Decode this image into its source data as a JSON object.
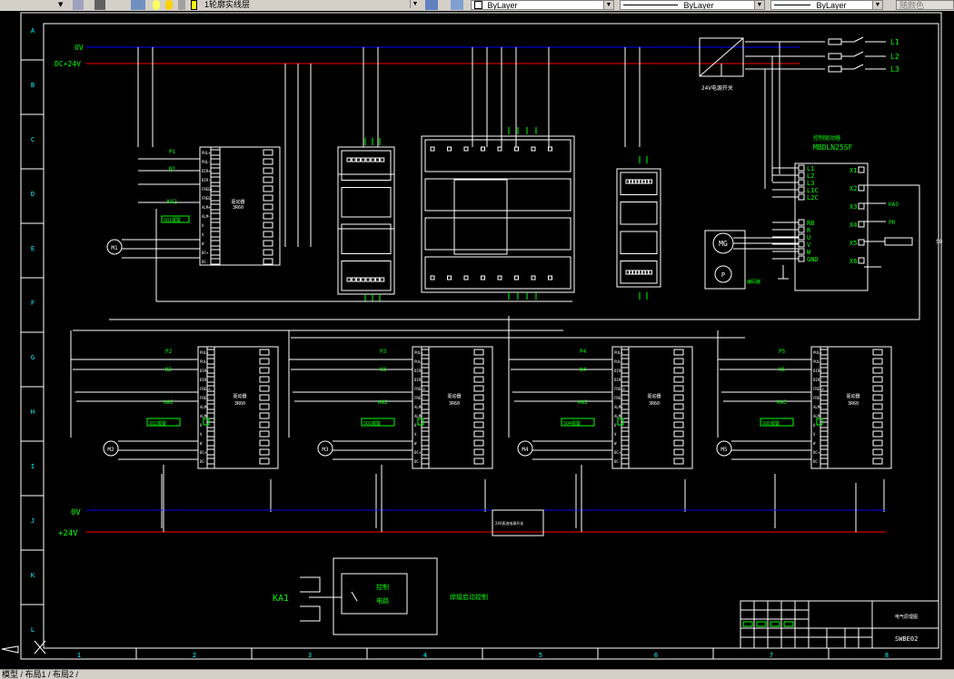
{
  "toolbar": {
    "layer_name": "1轮廓实线层",
    "linetype_1": "ByLayer",
    "linetype_2": "ByLayer",
    "linetype_3": "ByLayer",
    "color_box": "随颜色"
  },
  "status": {
    "tabs_text": "模型 / 布局1 / 布局2 /"
  },
  "drawing": {
    "colors": {
      "bg": "#000000",
      "border": "#ffffff",
      "zero_v": "#0000ff",
      "plus_24v": "#ff0000",
      "label": "#00ff00",
      "cyan": "#00ffff"
    },
    "row_letters": [
      "A",
      "B",
      "C",
      "D",
      "E",
      "F",
      "G",
      "H",
      "I",
      "J",
      "K",
      "L"
    ],
    "col_numbers": [
      "1",
      "2",
      "3",
      "4",
      "5",
      "6",
      "7",
      "8"
    ],
    "top_rail_0v": "0V",
    "top_rail_24v": "DC+24V",
    "bottom_rail_0v": "0V",
    "bottom_rail_24v": "+24V",
    "phases": [
      "L1",
      "L2",
      "L3"
    ],
    "psu_label": "24V电源开关",
    "vfd": {
      "title": "控制驱动器",
      "model": "MBDLN25SF",
      "left_pins": [
        "L1",
        "L2",
        "L3",
        "L1C",
        "L2C",
        "RB",
        "R",
        "U",
        "V",
        "W",
        "GND"
      ],
      "right_pins": [
        "X1",
        "X2",
        "X3",
        "X4",
        "X5",
        "X6"
      ],
      "x3_label": "KA3",
      "x4_label": "PR",
      "motor": "MG",
      "encoder": "P",
      "enc_text": "编码器",
      "side_label": "SQ"
    },
    "top_driver": {
      "pins_left": [
        "PUL+",
        "PUL-",
        "DIR+",
        "DIR-",
        "FREE+",
        "FREE-",
        "ALM+",
        "ALM-",
        "U",
        "V",
        "W",
        "DC+",
        "DC-"
      ],
      "p": "P1",
      "n": "N1",
      "ka": "KA2",
      "alarm": "SQ1报警",
      "motor": "M1",
      "name": "驱动器",
      "model": "3R60"
    },
    "drivers": [
      {
        "p": "P2",
        "n": "N2",
        "ka": "KA2",
        "alarm": "SQ2报警",
        "motor": "M2",
        "name": "驱动器",
        "model": "3R60"
      },
      {
        "p": "P3",
        "n": "N3",
        "ka": "KA2",
        "alarm": "SQ3报警",
        "motor": "M3",
        "name": "驱动器",
        "model": "3R60"
      },
      {
        "p": "P4",
        "n": "N4",
        "ka": "KA2",
        "alarm": "SQ4报警",
        "motor": "M4",
        "name": "驱动器",
        "model": "3R60"
      },
      {
        "p": "P5",
        "n": "N5",
        "ka": "KA3",
        "alarm": "SQ5报警",
        "motor": "M5",
        "name": "驱动器",
        "model": "3R60"
      }
    ],
    "bottom_psu": "24V直流电源开关",
    "ka1": "KA1",
    "ctrl_box_l1": "控制",
    "ctrl_box_l2": "电路",
    "ctrl_desc": "焊接启动控制",
    "title_block": {
      "drawing_title": "电气原理图",
      "drawing_no": "SWBE02"
    }
  }
}
